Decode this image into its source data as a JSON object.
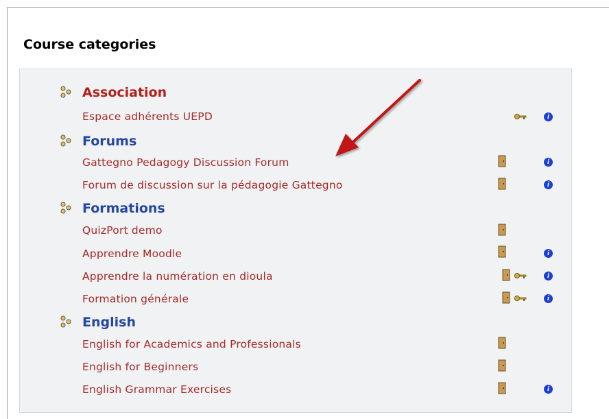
{
  "block": {
    "title": "Course categories"
  },
  "categories": [
    {
      "name": "Association",
      "courses": [
        {
          "name": "Espace adhérents UEPD"
        }
      ]
    },
    {
      "name": "Forums",
      "courses": [
        {
          "name": "Gattegno Pedagogy Discussion Forum"
        },
        {
          "name": "Forum de discussion sur la pédagogie Gattegno"
        }
      ]
    },
    {
      "name": "Formations",
      "courses": [
        {
          "name": "QuizPort demo"
        },
        {
          "name": "Apprendre Moodle"
        },
        {
          "name": "Apprendre la numération en dioula"
        },
        {
          "name": "Formation générale"
        }
      ]
    },
    {
      "name": "English",
      "courses": [
        {
          "name": "English for Academics and Professionals"
        },
        {
          "name": "English for Beginners"
        },
        {
          "name": "English Grammar Exercises"
        }
      ]
    }
  ],
  "icons": {
    "category": "category-icon",
    "guest_access": "door-icon",
    "enrolment_key": "key-icon",
    "summary": "info-icon",
    "annotation": "red-arrow"
  },
  "colors": {
    "category_link": "#2647a0",
    "association_link": "#b3201c",
    "course_link": "#a52a2a",
    "info": "#1a3fd2",
    "panel_bg": "#f0f2f3",
    "arrow": "#c01818"
  }
}
